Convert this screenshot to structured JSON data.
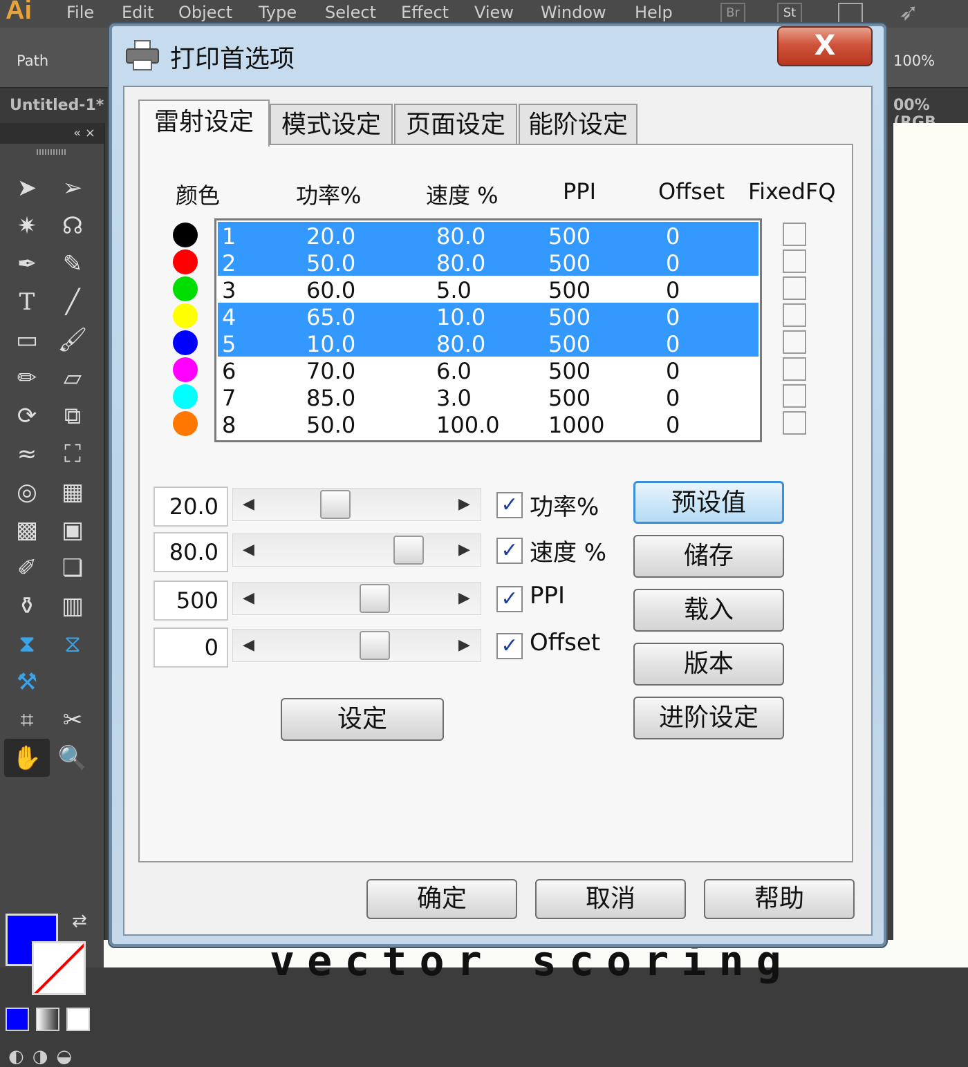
{
  "app": {
    "logo": "Ai",
    "menus": [
      "File",
      "Edit",
      "Object",
      "Type",
      "Select",
      "Effect",
      "View",
      "Window",
      "Help"
    ],
    "menubar_icons": [
      "Br",
      "St"
    ],
    "control_label": "Path",
    "zoom_text": "100%",
    "doc_tab": "Untitled-1*",
    "doc_tab_right": "00% (RGB",
    "panel_collapse": "«  ×",
    "fill_color": "#0000ff",
    "artboard_text": "vector scoring"
  },
  "dialog": {
    "title": "打印首选项",
    "close_label": "X",
    "tabs": [
      "雷射设定",
      "模式设定",
      "页面设定",
      "能阶设定"
    ],
    "active_tab": 0,
    "table": {
      "headers": [
        "颜色",
        "功率%",
        "速度 %",
        "PPI",
        "Offset",
        "FixedFQ"
      ],
      "rows": [
        {
          "id": "1",
          "power": "20.0",
          "speed": "80.0",
          "ppi": "500",
          "offset": "0",
          "color": "#000000",
          "selected": true
        },
        {
          "id": "2",
          "power": "50.0",
          "speed": "80.0",
          "ppi": "500",
          "offset": "0",
          "color": "#ff0000",
          "selected": true
        },
        {
          "id": "3",
          "power": "60.0",
          "speed": "5.0",
          "ppi": "500",
          "offset": "0",
          "color": "#00dd00",
          "selected": false
        },
        {
          "id": "4",
          "power": "65.0",
          "speed": "10.0",
          "ppi": "500",
          "offset": "0",
          "color": "#ffff00",
          "selected": true
        },
        {
          "id": "5",
          "power": "10.0",
          "speed": "80.0",
          "ppi": "500",
          "offset": "0",
          "color": "#0000ff",
          "selected": true
        },
        {
          "id": "6",
          "power": "70.0",
          "speed": "6.0",
          "ppi": "500",
          "offset": "0",
          "color": "#ff00ff",
          "selected": false
        },
        {
          "id": "7",
          "power": "85.0",
          "speed": "3.0",
          "ppi": "500",
          "offset": "0",
          "color": "#00ffff",
          "selected": false
        },
        {
          "id": "8",
          "power": "50.0",
          "speed": "100.0",
          "ppi": "1000",
          "offset": "0",
          "color": "#ff7700",
          "selected": false
        }
      ]
    },
    "controls": [
      {
        "value": "20.0",
        "label": "功率%",
        "checked": true,
        "check_mark": "✓",
        "slider_position": 0.35
      },
      {
        "value": "80.0",
        "label": "速度 %",
        "checked": true,
        "check_mark": "✓",
        "slider_position": 0.78
      },
      {
        "value": "500",
        "label": "PPI",
        "checked": true,
        "check_mark": "✓",
        "slider_position": 0.58
      },
      {
        "value": "0",
        "label": "Offset",
        "checked": true,
        "check_mark": "✓",
        "slider_position": 0.58
      }
    ],
    "set_button": "设定",
    "side_buttons": [
      "预设值",
      "储存",
      "载入",
      "版本",
      "进阶设定"
    ],
    "footer_buttons": [
      "确定",
      "取消",
      "帮助"
    ]
  }
}
